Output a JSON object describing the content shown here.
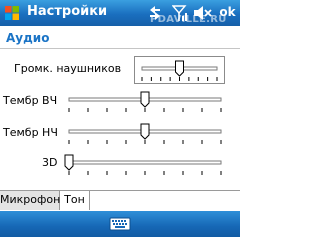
{
  "titlebar": {
    "title": "Настройки",
    "ok_label": "ok",
    "watermark": "PDAVILLE.RU",
    "icons": [
      "start-flag-icon",
      "sync-arrows-icon",
      "signal-strength-icon",
      "speaker-muted-icon"
    ]
  },
  "page": {
    "header": "Аудио"
  },
  "sliders": [
    {
      "label": "Громк. наушников",
      "value": 0.5,
      "focused": true
    },
    {
      "label": "Тембр ВЧ",
      "value": 0.5,
      "focused": false
    },
    {
      "label": "Тембр НЧ",
      "value": 0.5,
      "focused": false
    },
    {
      "label": "3D",
      "value": 0.0,
      "focused": false
    }
  ],
  "tabs": [
    {
      "label": "Микрофон",
      "active": false
    },
    {
      "label": "Тон",
      "active": true
    }
  ],
  "menubar": {
    "sip_icon": "keyboard-icon"
  },
  "colors": {
    "titlebar": "#1a6fbf",
    "header_text": "#1b74c6",
    "tab_inactive": "#e4e4e4"
  }
}
